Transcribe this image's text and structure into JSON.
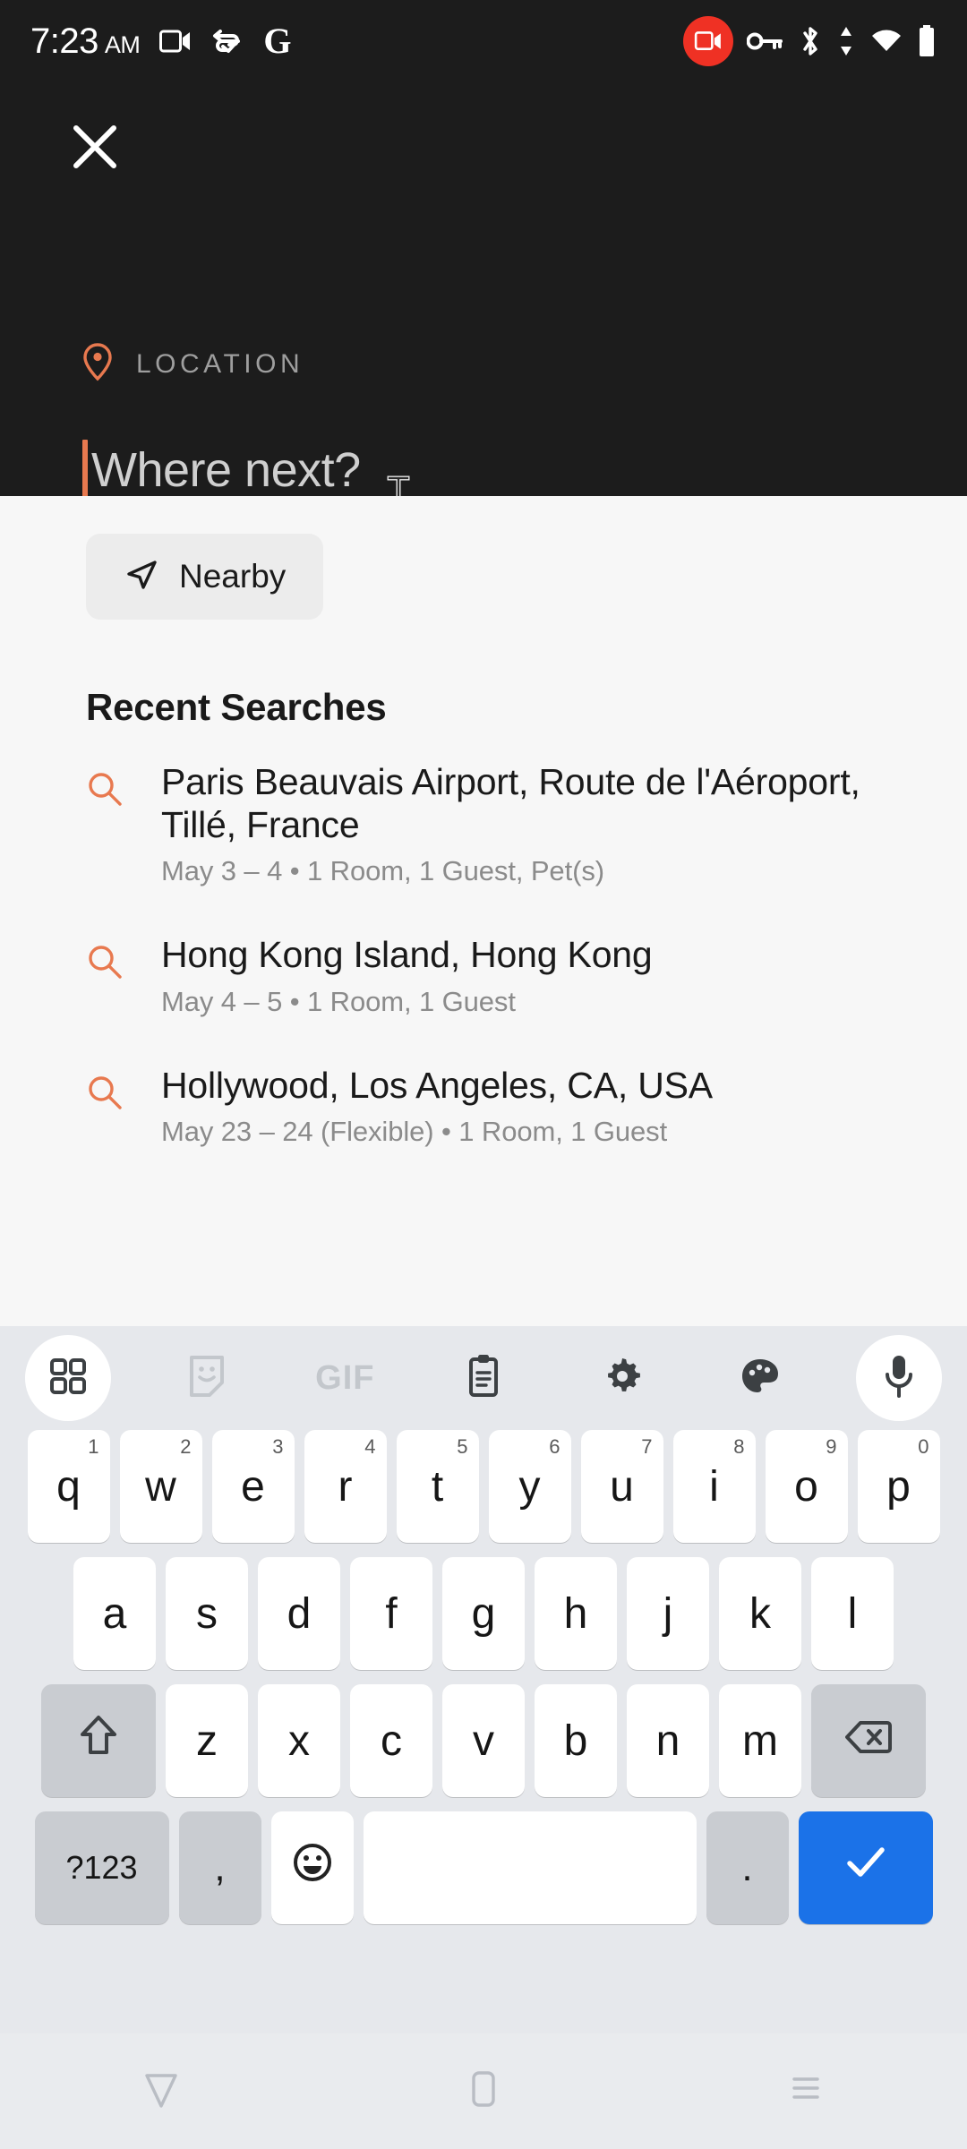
{
  "statusbar": {
    "time": "7:23",
    "ampm": "AM",
    "left_icons": [
      "screen-record-icon",
      "sync-vpn-icon",
      "google-icon"
    ],
    "right_icons": [
      "screen-recording-active-badge",
      "vpn-key-icon",
      "bluetooth-icon",
      "data-transfer-icon",
      "wifi-icon",
      "battery-icon"
    ],
    "accent_red": "#ef3124"
  },
  "header": {
    "background": "#1c1c1c",
    "close_icon": "close-icon",
    "location_label": "LOCATION",
    "pin_icon": "location-pin-icon",
    "pin_color": "#e8794f",
    "search_placeholder": "Where next?",
    "search_value": "",
    "caret_color": "#e8794f"
  },
  "content": {
    "nearby_chip": {
      "label": "Nearby",
      "icon": "navigation-arrow-icon"
    },
    "section_title": "Recent Searches",
    "recent_searches": [
      {
        "icon": "search-icon",
        "title": "Paris Beauvais Airport, Route de l'Aéroport, Tillé, France",
        "subtitle": "May 3 – 4 • 1 Room, 1 Guest, Pet(s)"
      },
      {
        "icon": "search-icon",
        "title": "Hong Kong Island, Hong Kong",
        "subtitle": "May 4 – 5 • 1 Room, 1 Guest"
      },
      {
        "icon": "search-icon",
        "title": "Hollywood, Los Angeles, CA, USA",
        "subtitle": "May 23 – 24 (Flexible) • 1 Room, 1 Guest"
      }
    ]
  },
  "keyboard": {
    "toolbar_icons": [
      "apps-grid-icon",
      "sticker-icon",
      "gif-icon",
      "clipboard-icon",
      "gear-icon",
      "palette-icon",
      "microphone-icon"
    ],
    "gif_label": "GIF",
    "row1": [
      {
        "key": "q",
        "sup": "1"
      },
      {
        "key": "w",
        "sup": "2"
      },
      {
        "key": "e",
        "sup": "3"
      },
      {
        "key": "r",
        "sup": "4"
      },
      {
        "key": "t",
        "sup": "5"
      },
      {
        "key": "y",
        "sup": "6"
      },
      {
        "key": "u",
        "sup": "7"
      },
      {
        "key": "i",
        "sup": "8"
      },
      {
        "key": "o",
        "sup": "9"
      },
      {
        "key": "p",
        "sup": "0"
      }
    ],
    "row2": [
      {
        "key": "a"
      },
      {
        "key": "s"
      },
      {
        "key": "d"
      },
      {
        "key": "f"
      },
      {
        "key": "g"
      },
      {
        "key": "h"
      },
      {
        "key": "j"
      },
      {
        "key": "k"
      },
      {
        "key": "l"
      }
    ],
    "row3": [
      {
        "key": "z"
      },
      {
        "key": "x"
      },
      {
        "key": "c"
      },
      {
        "key": "v"
      },
      {
        "key": "b"
      },
      {
        "key": "n"
      },
      {
        "key": "m"
      }
    ],
    "shift_icon": "shift-icon",
    "backspace_icon": "backspace-icon",
    "numeric_label": "?123",
    "comma_label": ",",
    "emoji_icon": "emoji-icon",
    "space_label": "",
    "period_label": ".",
    "enter_icon": "checkmark-icon",
    "enter_color": "#1b72e8"
  },
  "navbar": {
    "back_icon": "back-triangle-icon",
    "home_icon": "home-pill-icon",
    "recents_icon": "recents-lines-icon"
  }
}
